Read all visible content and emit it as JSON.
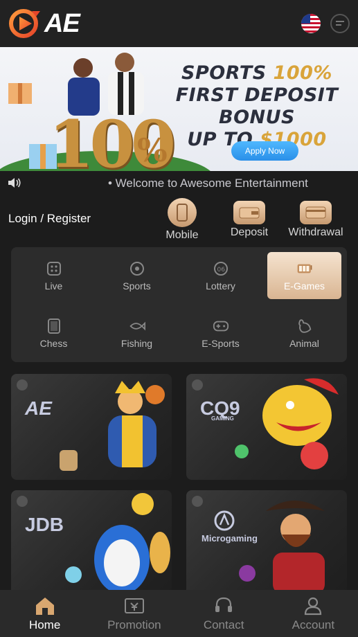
{
  "header": {
    "logo_text": "AE",
    "language_icon": "us-flag-icon",
    "chat_icon": "chat-icon"
  },
  "banner": {
    "title_line1_a": "SPORTS ",
    "title_line1_b": "100%",
    "title_line2": "FIRST DEPOSIT BONUS",
    "title_line3_a": "UP TO ",
    "title_line3_b": "$1000",
    "big_number": "100",
    "big_percent": "%",
    "apply_label": "Apply Now"
  },
  "marquee": {
    "text": "• Welcome to Awesome Entertainment"
  },
  "account": {
    "login_label": "Login / Register"
  },
  "quick_actions": [
    {
      "label": "Mobile",
      "icon": "mobile-icon"
    },
    {
      "label": "Deposit",
      "icon": "wallet-icon"
    },
    {
      "label": "Withdrawal",
      "icon": "card-icon"
    }
  ],
  "categories": [
    {
      "label": "Live",
      "icon": "dice-icon"
    },
    {
      "label": "Sports",
      "icon": "ball-icon"
    },
    {
      "label": "Lottery",
      "icon": "lottery-icon"
    },
    {
      "label": "E-Games",
      "icon": "slot-icon",
      "active": true
    },
    {
      "label": "Chess",
      "icon": "cards-icon"
    },
    {
      "label": "Fishing",
      "icon": "fish-icon"
    },
    {
      "label": "E-Sports",
      "icon": "gamepad-icon"
    },
    {
      "label": "Animal",
      "icon": "rooster-icon"
    }
  ],
  "game_providers": [
    {
      "brand": "AE"
    },
    {
      "brand": "CQ9",
      "sub": "GAMING"
    },
    {
      "brand": "JDB"
    },
    {
      "brand": "Microgaming"
    }
  ],
  "bottom_nav": [
    {
      "label": "Home",
      "icon": "home-icon",
      "active": true
    },
    {
      "label": "Promotion",
      "icon": "ticket-icon"
    },
    {
      "label": "Contact",
      "icon": "headset-icon"
    },
    {
      "label": "Account",
      "icon": "user-icon"
    }
  ],
  "colors": {
    "background": "#1c1c1c",
    "accent_gold": "#d9a43a",
    "active_tab": "#e7c7a4",
    "logo_orange": "#f26a2a"
  }
}
